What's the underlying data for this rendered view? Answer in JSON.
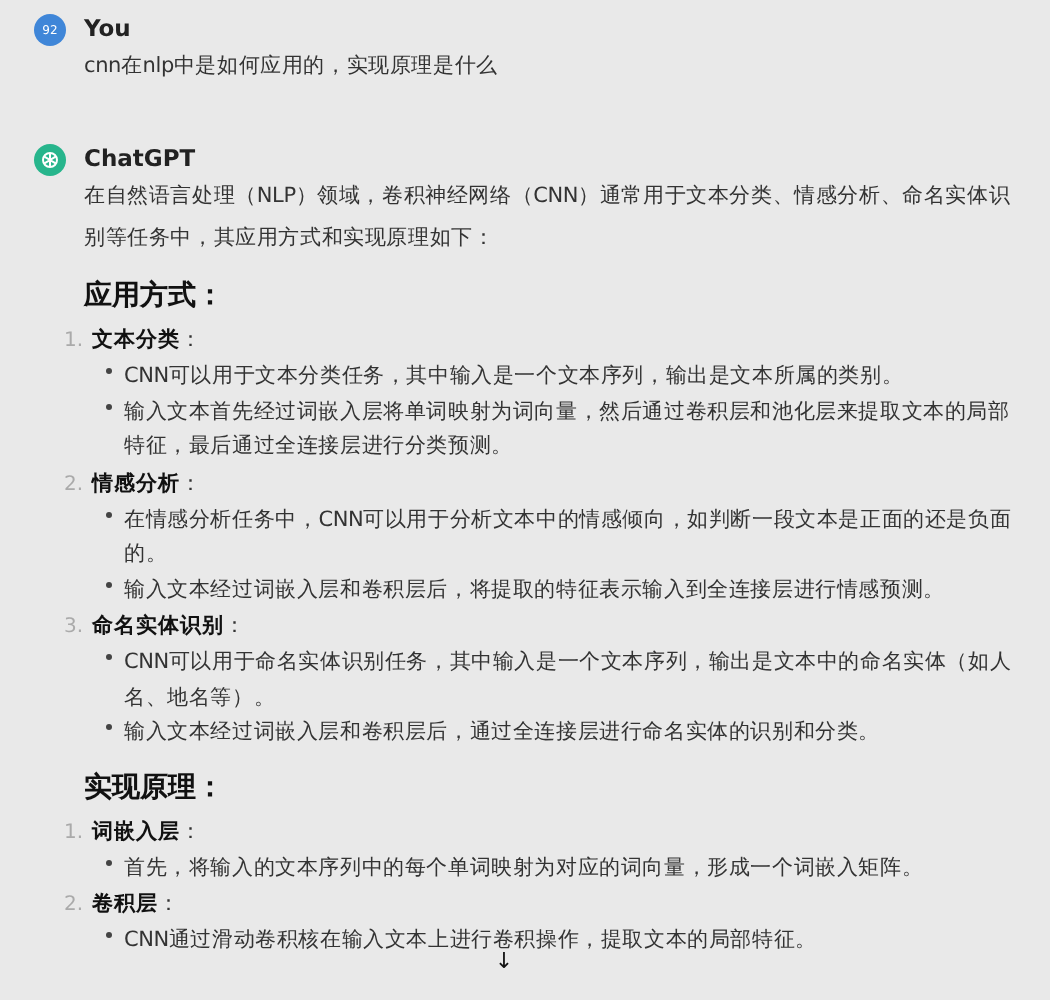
{
  "messages": [
    {
      "author": "You",
      "avatar": {
        "kind": "user",
        "label": "92"
      },
      "text": "cnn在nlp中是如何应用的，实现原理是什么"
    },
    {
      "author": "ChatGPT",
      "avatar": {
        "kind": "bot"
      },
      "text": "在自然语言处理（NLP）领域，卷积神经网络（CNN）通常用于文本分类、情感分析、命名实体识别等任务中，其应用方式和实现原理如下：",
      "sections": [
        {
          "heading": "应用方式：",
          "items": [
            {
              "number": "1.",
              "title": "**文本分类**：",
              "bullets": [
                "CNN可以用于文本分类任务，其中输入是一个文本序列，输出是文本所属的类别。",
                "输入文本首先经过词嵌入层将单词映射为词向量，然后通过卷积层和池化层来提取文本的局部特征，最后通过全连接层进行分类预测。"
              ]
            },
            {
              "number": "2.",
              "title": "**情感分析**：",
              "bullets": [
                "在情感分析任务中，CNN可以用于分析文本中的情感倾向，如判断一段文本是正面的还是负面的。",
                "输入文本经过词嵌入层和卷积层后，将提取的特征表示输入到全连接层进行情感预测。"
              ]
            },
            {
              "number": "3.",
              "title": "**命名实体识别**：",
              "bullets": [
                "CNN可以用于命名实体识别任务，其中输入是一个文本序列，输出是文本中的命名实体（如人名、地名等）。",
                "输入文本经过词嵌入层和卷积层后，通过全连接层进行命名实体的识别和分类。"
              ]
            }
          ]
        },
        {
          "heading": "实现原理：",
          "items": [
            {
              "number": "1.",
              "title": "**词嵌入层**：",
              "bullets": [
                "首先，将输入的文本序列中的每个单词映射为对应的词向量，形成一个词嵌入矩阵。"
              ]
            },
            {
              "number": "2.",
              "title": "**卷积层**：",
              "bullets": [
                "CNN通过滑动卷积核在输入文本上进行卷积操作，提取文本的局部特征。"
              ]
            }
          ]
        }
      ]
    }
  ],
  "scroll_button": {
    "icon": "↓"
  }
}
